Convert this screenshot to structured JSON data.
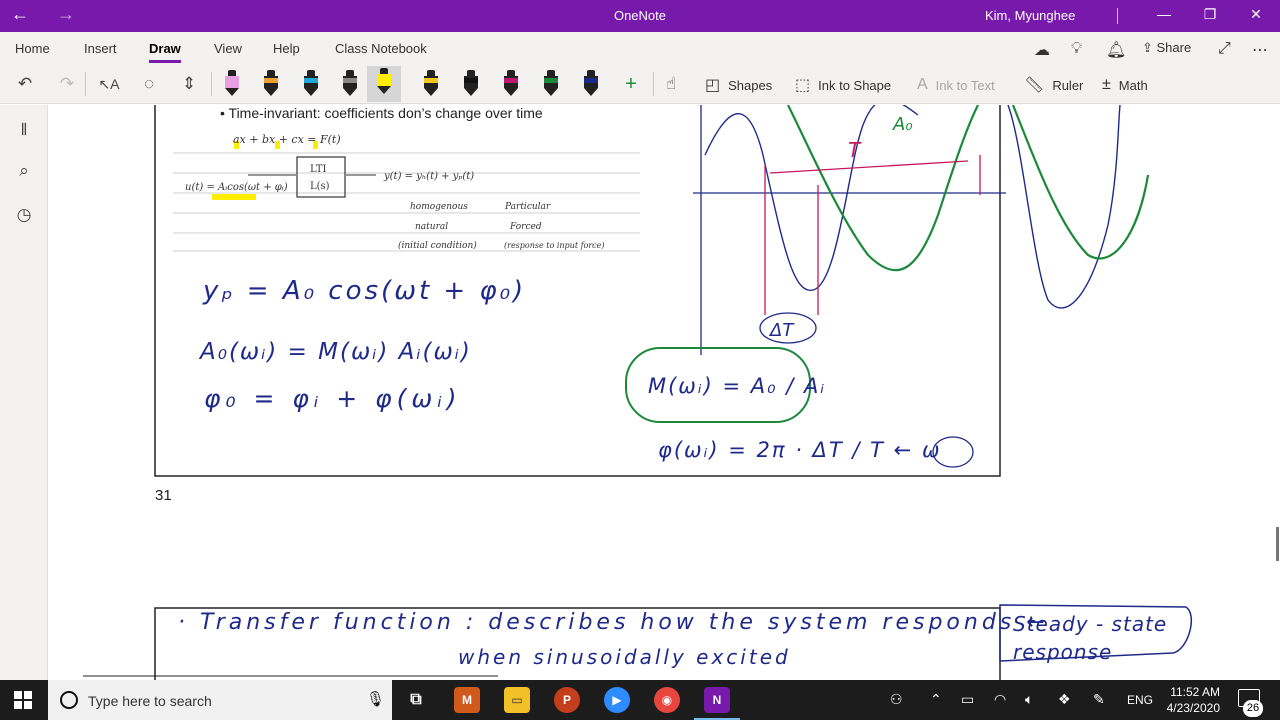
{
  "titlebar": {
    "app_title": "OneNote",
    "user": "Kim, Myunghee",
    "back": "←",
    "forward": "→",
    "minimize": "—",
    "restore": "❐",
    "close": "✕"
  },
  "ribbon": {
    "tabs": [
      "Home",
      "Insert",
      "Draw",
      "View",
      "Help",
      "Class Notebook"
    ],
    "active_tab": "Draw",
    "share_label": "Share"
  },
  "toolbar": {
    "shapes_label": "Shapes",
    "ink_to_shape_label": "Ink to Shape",
    "ink_to_text_label": "Ink to Text",
    "ruler_label": "Ruler",
    "math_label": "Math",
    "pens": [
      {
        "icon": "highlighter-pink-icon",
        "color": "#e6a0e0",
        "selected": false
      },
      {
        "icon": "pen-orange-icon",
        "color": "#f0a030",
        "selected": false
      },
      {
        "icon": "pen-cyan-icon",
        "color": "#20a8d8",
        "selected": false
      },
      {
        "icon": "pen-gray-icon",
        "color": "#888888",
        "selected": false
      },
      {
        "icon": "highlighter-yellow-icon",
        "color": "#ffee00",
        "selected": true
      },
      {
        "icon": "pen-yellow-icon",
        "color": "#f5c518",
        "selected": false
      },
      {
        "icon": "pen-black-icon",
        "color": "#111111",
        "selected": false
      },
      {
        "icon": "pen-magenta-icon",
        "color": "#c0186c",
        "selected": false
      },
      {
        "icon": "pen-green-icon",
        "color": "#1a8a3a",
        "selected": false
      },
      {
        "icon": "pen-navy-icon",
        "color": "#1a2a8a",
        "selected": false
      }
    ]
  },
  "page": {
    "page_number": "31",
    "bullet_text": "•  Time-invariant: coefficients don’s change over time",
    "diagram": {
      "equation": "ax + bx + cx = F(t)",
      "input": "u(t) = Aᵢcos(ωt + φᵢ)",
      "block_top": "LTI",
      "block_bottom": "L(s)",
      "output": "y(t) = yₕ(t) + yₚ(t)",
      "homogeneous": "homogenous",
      "natural": "natural",
      "initial": "(initial condition)",
      "particular": "Particular",
      "forced": "Forced",
      "response": "(response to input force)"
    },
    "handwriting": {
      "eq1": "yₚ = A₀ cos(ωt + φ₀)",
      "eq2": "A₀(ωᵢ) = M(ωᵢ) Aᵢ(ωᵢ)",
      "eq3": "φ₀ = φᵢ + φ(ωᵢ)",
      "magnitude": "M(ωᵢ) = A₀ / Aᵢ",
      "phase": "φ(ωᵢ) = 2π · ΔT / T ← ω",
      "graph_T": "T",
      "graph_A0": "A₀",
      "graph_dT": "ΔT"
    },
    "transfer_line1": "· Transfer  function :  describes  how  the  system  responds  ←",
    "transfer_line2": "when  sinusoidally  excited",
    "steady_state": "Steady - state\nresponse"
  },
  "taskbar": {
    "search_placeholder": "Type here to search",
    "time": "11:52 AM",
    "date": "4/23/2020",
    "language": "ENG",
    "notification_count": "26"
  },
  "colors": {
    "onenote_purple": "#7719aa",
    "ink_blue": "#1e2a8a",
    "ink_green": "#1a8a3a",
    "ink_pink": "#c8185c",
    "highlight_yellow": "#ffee00"
  }
}
